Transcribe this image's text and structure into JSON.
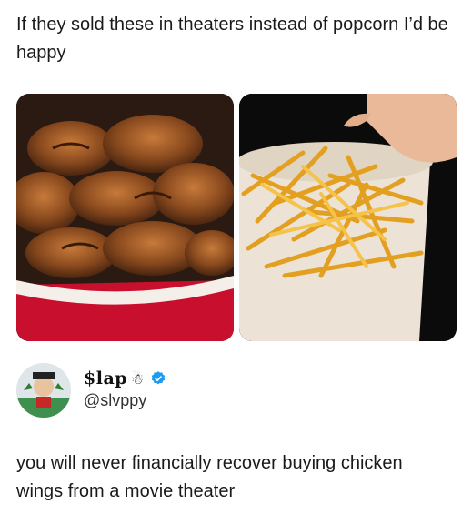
{
  "post": {
    "text": "If they sold these in theaters instead of popcorn I’d be happy"
  },
  "media": {
    "left_image_alt": "bucket of chicken wings",
    "right_image_alt": "bucket of french fries"
  },
  "author": {
    "display_name": "$lap",
    "name_emoji": "☃",
    "handle": "@slvppy",
    "verified": true
  },
  "reply": {
    "text": "you will never financially recover buying chicken wings from a movie theater"
  },
  "colors": {
    "verified_blue": "#1d9bf0",
    "bucket_red": "#c8102e",
    "text": "#1a1a1a"
  }
}
